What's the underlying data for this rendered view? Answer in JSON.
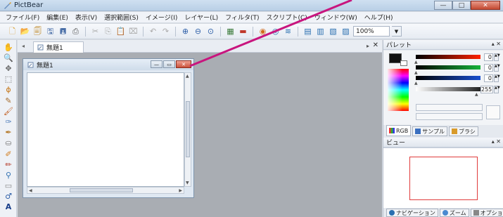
{
  "window": {
    "title": "PictBear",
    "minimize": "—",
    "maximize": "□",
    "close": "✕"
  },
  "menu": [
    "ファイル(F)",
    "編集(E)",
    "表示(V)",
    "選択範囲(S)",
    "イメージ(I)",
    "レイヤー(L)",
    "フィルタ(T)",
    "スクリプト(C)",
    "ウィンドウ(W)",
    "ヘルプ(H)"
  ],
  "toolbar": {
    "zoom": "100%"
  },
  "tabs": {
    "document_tab": "無題1"
  },
  "document": {
    "title": "無題1"
  },
  "palette": {
    "title": "パレット",
    "red_value": "0",
    "green_value": "0",
    "blue_value": "0",
    "alpha_value": "255",
    "tabs": [
      "RGB",
      "サンプル",
      "ブラシ"
    ]
  },
  "view": {
    "title": "ビュー",
    "tabs": [
      "ナビゲーション",
      "ズーム",
      "オプション"
    ]
  },
  "colors": {
    "annotation": "#c8157e",
    "view_frame": "#e03b3b"
  }
}
